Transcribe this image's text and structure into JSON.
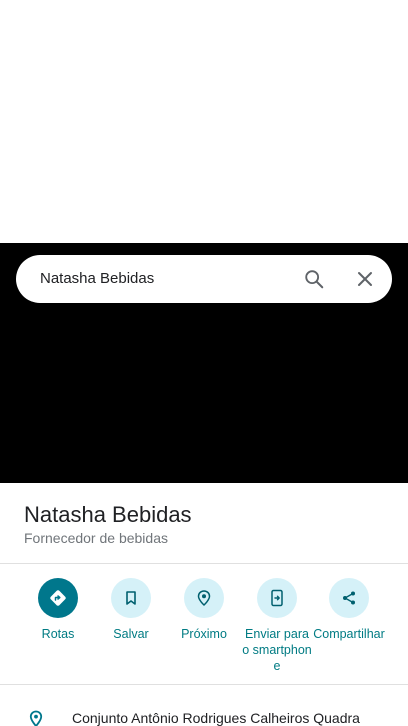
{
  "search": {
    "query": "Natasha Bebidas"
  },
  "place": {
    "name": "Natasha Bebidas",
    "category": "Fornecedor de bebidas",
    "address": "Conjunto Antônio Rodrigues Calheiros Quadra"
  },
  "actions": [
    {
      "label": "Rotas",
      "icon": "directions-icon"
    },
    {
      "label": "Salvar",
      "icon": "bookmark-icon"
    },
    {
      "label": "Próximo",
      "icon": "nearby-icon"
    },
    {
      "label": "Enviar para o smartphone",
      "icon": "send-to-phone-icon"
    },
    {
      "label": "Compartilhar",
      "icon": "share-icon"
    }
  ],
  "colors": {
    "accent": "#00778c",
    "action_bg": "#d5f1f8",
    "action_text": "#007b83",
    "map": "#000000"
  }
}
